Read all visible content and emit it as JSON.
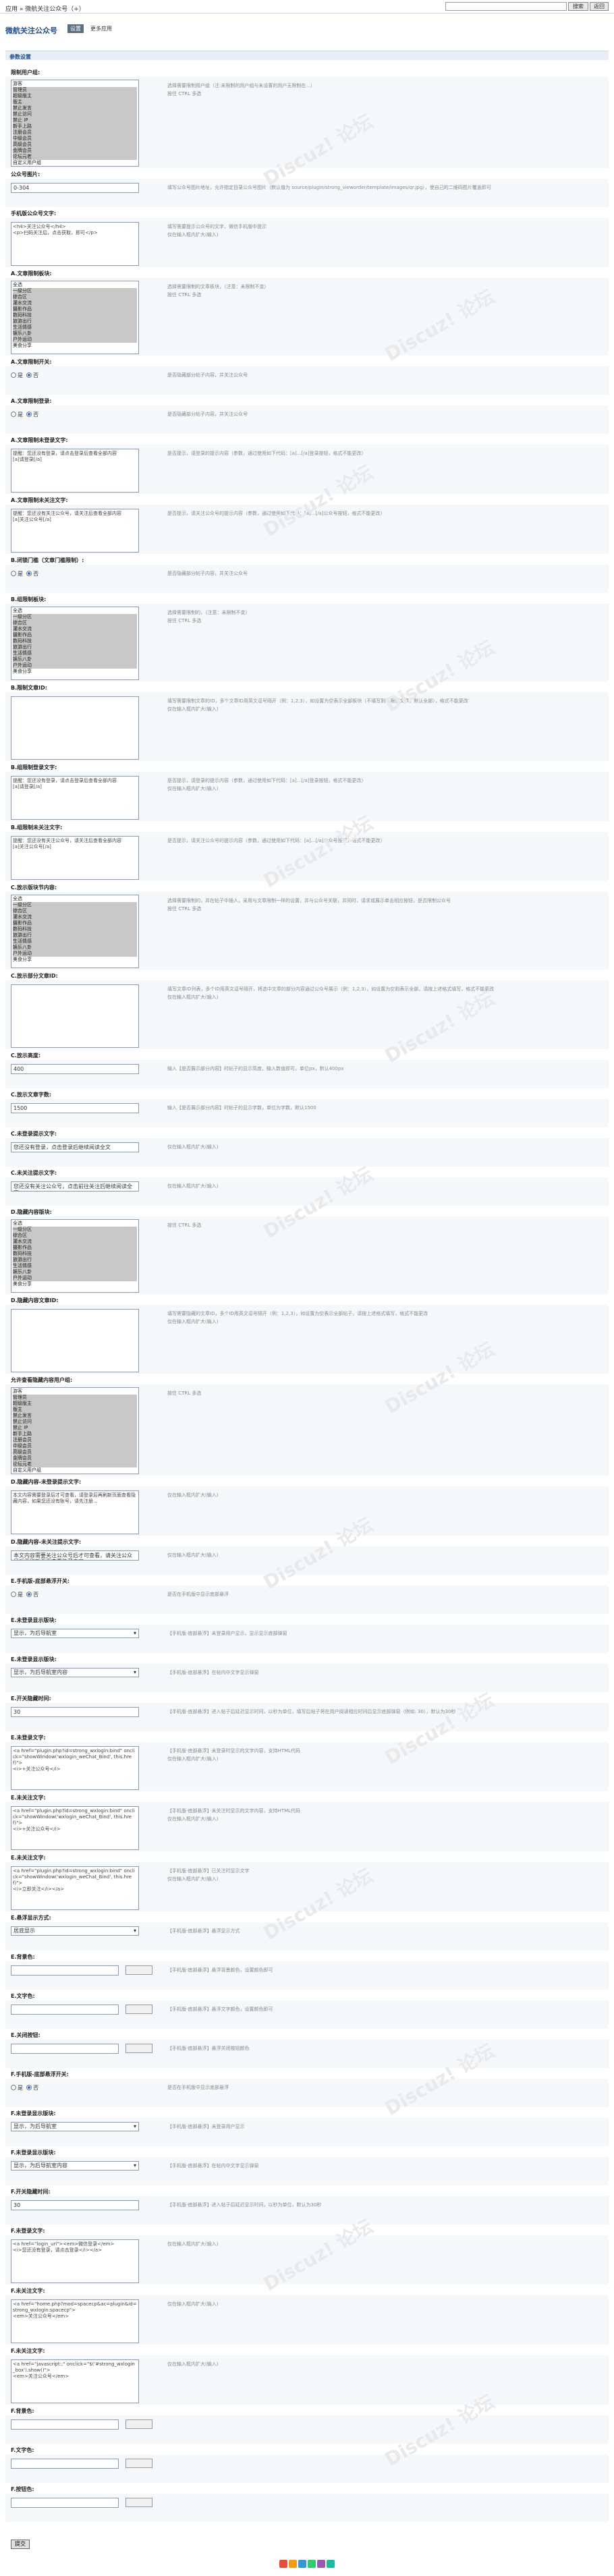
{
  "topbar": {
    "breadcrumb": "应用 » 微航关注公众号（+）",
    "search_button": "搜索",
    "top_button": "返回"
  },
  "header": {
    "title": "微航关注公众号",
    "tab_active": "设置",
    "tab_other": "更多应用"
  },
  "section_title": "参数设置",
  "fields": [
    {
      "label": "限制用户组:",
      "tip": "选择需要限制用户组（注:未限制的用户组与未设置的用户无限制在...）",
      "tip2": "按住 CTRL 多选",
      "options": [
        "游客",
        "管理员",
        "超级版主",
        "版主",
        "禁止发言",
        "禁止访问",
        "禁止 IP",
        "新手上路",
        "注册会员",
        "中级会员",
        "高级会员",
        "金牌会员",
        "论坛元老",
        "自定义用户组"
      ]
    },
    {
      "label": "公众号图片:",
      "value": "0-304",
      "tip": "填写公众号图片地址，允许指定目录公众号图片（默认值为 source/plugin/strong_vieworder/template/images/qr.jpg），使自己的二维码图片覆盖即可"
    },
    {
      "label": "手机版公众号文字:",
      "value": "<h4>关注公众号</h4>\n<p>扫码关注后，点击获取，即可</p>",
      "tip": "填写需要提示公众号的文字，微信手机版中提示",
      "tip2": "仅在输入框内扩大(输入)"
    },
    {
      "label": "A.文章限制板块:",
      "tip": "选择需要限制的文章板块，（注意：未限制不变）",
      "tip2": "按住 CTRL 多选",
      "options": [
        "全选",
        "一级分区",
        "  综合区",
        "  灌水交流",
        "  摄影作品",
        "  数码科技",
        "  旅游出行",
        "  生活情感",
        "  娱乐八卦",
        "  户外运动",
        "  美食分享"
      ]
    },
    {
      "label": "A.文章限制开关:",
      "radio_on": "是",
      "radio_off": "否",
      "tip": "是否隐藏部分帖子内容，并关注公众号"
    },
    {
      "label": "A.文章限制登录:",
      "radio_on": "是",
      "radio_off": "否",
      "tip": "是否隐藏部分帖子内容，并关注公众号"
    },
    {
      "label": "A.文章限制未登录文字:",
      "value": "提醒：您还没有登录，请点击登录后查看全部内容\n[a]请登录[/a]",
      "tip": "是否提示，请登录的提示内容（参数，通过使用如下代码：[a]...[/a]登录按钮，格式不能更改）"
    },
    {
      "label": "A.文章限制未关注文字:",
      "value": "提醒：您还没有关注公众号，请关注后查看全部内容\n[a]关注公众号[/a]",
      "tip": "是否提示，请关注公众号的提示内容（参数，通过使用如下代码：[a]...[/a]公众号按钮，格式不能更改）"
    },
    {
      "label": "B.闭锁门槛（文章门槛限制）:",
      "radio_on": "是",
      "radio_off": "否",
      "tip": "是否隐藏部分帖子内容，并关注公众号"
    },
    {
      "label": "B.组限制板块:",
      "tip": "选择需要限制的，（注意：未限制不变）",
      "tip2": "按住 CTRL 多选",
      "options": [
        "全选",
        "一级分区",
        "  综合区",
        "  灌水交流",
        "  摄影作品",
        "  数码科技",
        "  旅游出行",
        "  生活情感",
        "  娱乐八卦",
        "  户外运动",
        "  美食分享"
      ]
    },
    {
      "label": "B.限制文章ID:",
      "value": "",
      "tip": "填写需要限制文章的ID，多个文章ID用英文逗号隔开（例：1,2,3），如设置为空表示全部板块（不填写则不限制文章，默认全部），格式不能更改",
      "tip2": "仅在输入框内扩大(输入)"
    },
    {
      "label": "B.组限制登录文字:",
      "value": "提醒：您还没有登录，请点击登录后查看全部内容\n[a]请登录[/a]",
      "tip": "是否提示，请登录的提示内容（参数，通过使用如下代码：[a]...[/a]登录按钮，格式不能更改）",
      "tip2": "仅在输入框内扩大(输入)"
    },
    {
      "label": "B.组限制未关注文字:",
      "value": "提醒：您还没有关注公众号，请关注后查看全部内容\n[a]关注公众号[/a]",
      "tip": "是否提示，请关注公众号的提示内容（参数，通过使用如下代码：[a]...[/a]公众号按钮，格式不能更改）"
    },
    {
      "label": "C.放示版块节内容:",
      "tip": "选择需要限制的，并在帖子中插入，采用与文章限制一样的设置，并与公众号关联，并同时，请求或展示单击相应按钮，是否限制公众号",
      "tip2": "按住 CTRL 多选",
      "options": [
        "全选",
        "一级分区",
        "  综合区",
        "  灌水交流",
        "  摄影作品",
        "  数码科技",
        "  旅游出行",
        "  生活情感",
        "  娱乐八卦",
        "  户外运动",
        "  美食分享"
      ]
    },
    {
      "label": "C.放示部分文章ID:",
      "value": "",
      "tip": "填写文章ID列表，多个ID用英文逗号隔开，将选中文章的部分内容通过公众号展示（例：1,2,3），如设置为空则表示全部，请按上述格式填写，格式不能更改",
      "tip2": "仅在输入框内扩大(输入)"
    },
    {
      "label": "C.放示高度:",
      "value": "400",
      "tip": "输入【是否展示部分内容】时帖子的显示高度，输入数值即可，单位px，默认400px"
    },
    {
      "label": "C.放示文章字数:",
      "value": "1500",
      "tip": "输入【是否展示部分内容】时帖子的显示字数，单位为字数，默认1500"
    },
    {
      "label": "C.未登录提示文字:",
      "value": "您还没有登录，点击登录后继续阅读全文",
      "tip": "仅在输入框内扩大(输入)"
    },
    {
      "label": "C.未关注提示文字:",
      "value": "您还没有关注公众号，点击前往关注后继续阅读全文",
      "tip": "仅在输入框内扩大(输入)"
    },
    {
      "label": "D.隐藏内容版块:",
      "tip": "按住 CTRL 多选",
      "options": [
        "全选",
        "一级分区",
        "  综合区",
        "  灌水交流",
        "  摄影作品",
        "  数码科技",
        "  旅游出行",
        "  生活情感",
        "  娱乐八卦",
        "  户外运动",
        "  美食分享"
      ]
    },
    {
      "label": "D.隐藏内容文章ID:",
      "value": "",
      "tip": "填写需要隐藏的文章ID，多个ID用英文逗号隔开（例：1,2,3），如设置为空表示全部帖子，请按上述格式填写，格式不能更改",
      "tip2": "仅在输入框内扩大(输入)"
    },
    {
      "label": "允许查看隐藏内容用户组:",
      "tip": "按住 CTRL 多选",
      "options": [
        "游客",
        "管理员",
        "超级版主",
        "版主",
        "禁止发言",
        "禁止访问",
        "禁止 IP",
        "新手上路",
        "注册会员",
        "中级会员",
        "高级会员",
        "金牌会员",
        "论坛元老",
        "自定义用户组"
      ]
    },
    {
      "label": "D.隐藏内容-未登录提示文字:",
      "value": "本文内容需要登录后才可查看，请登录后再刷新页面查看隐藏内容，如果您还没有账号，请先注册...",
      "tip": "仅在输入框内扩大(输入)"
    },
    {
      "label": "D.隐藏内容-未关注提示文字:",
      "value": "本文内容需要关注公众号后才可查看，请关注公众号后再刷新页面查看隐藏内容...",
      "tip": "仅在输入框内扩大(输入)"
    },
    {
      "label": "E.手机版-底部悬浮开关:",
      "radio_on": "是",
      "radio_off": "否",
      "tip": "是否在手机版中显示底部悬浮"
    },
    {
      "label": "E.未登录显示版块:",
      "dd": "显示，为后导航室",
      "tip": "【手机版-底部悬浮】未登录用户显示，显示显示底部弹窗"
    },
    {
      "label": "E.未登录显示版块:",
      "dd": "显示，为后导航室内容",
      "tip": "【手机版-底部悬浮】在帖内中文字显示弹窗"
    },
    {
      "label": "E.开关隐藏时间:",
      "value": "30",
      "tip": "【手机版-底部悬浮】进入帖子后延迟显示时间，以秒为单位，填写后帖子将在用户阅读相应时间后显示底部弹窗（例如: 30），默认为30秒"
    },
    {
      "label": "E.未登录文字:",
      "value": "<a href=\"plugin.php?id=strong_wxlogin:bind\" onclick=\"showWindow('wxlogin_weChat_Bind', this.href)\">\n<i>+关注公众号</i>",
      "tip": "【手机版-底部悬浮】未登录时显示的文字内容，支持HTML代码",
      "tip2": "仅在输入框内扩大(输入)"
    },
    {
      "label": "E.未关注文字:",
      "value": "<a href=\"plugin.php?id=strong_wxlogin:bind\" onclick=\"showWindow('wxlogin_weChat_Bind', this.href)\">\n<i>+关注公众号</i>",
      "tip": "【手机版-底部悬浮】未关注时显示的文字内容，支持HTML代码",
      "tip2": "仅在输入框内扩大(输入)"
    },
    {
      "label": "E.未关注文字:",
      "value": "<a href=\"plugin.php?id=strong_wxlogin:bind\" onclick=\"showWindow('wxlogin_weChat_Bind', this.href)\">\n<i>立即关注</i></a>",
      "tip": "【手机版-底部悬浮】已关注时显示文字",
      "tip2": "仅在输入框内扩大(输入)"
    },
    {
      "label": "E.悬浮显示方式:",
      "dd": "居底显示",
      "tip": "【手机版-底部悬浮】悬浮显示方式"
    },
    {
      "label": "E.背景色:",
      "value": "",
      "tip": "【手机版-底部悬浮】悬浮背景颜色，设置颜色即可"
    },
    {
      "label": "E.文字色:",
      "value": "",
      "tip": "【手机版-底部悬浮】悬浮文字颜色，设置颜色即可"
    },
    {
      "label": "E.关闭按钮:",
      "value": "",
      "tip": "【手机版-底部悬浮】悬浮关闭按钮颜色"
    },
    {
      "label": "F.手机版-底部悬浮开关:",
      "radio_on": "是",
      "radio_off": "否",
      "tip": "是否在手机版中显示底部悬浮"
    },
    {
      "label": "F.未登录显示版块:",
      "dd": "显示，为后导航室",
      "tip": "【手机版-底部悬浮】未登录用户显示"
    },
    {
      "label": "F.未登录显示版块:",
      "dd": "显示，为后导航室内容",
      "tip": "【手机版-底部悬浮】在帖内中文字显示弹窗"
    },
    {
      "label": "F.开关隐藏时间:",
      "value": "30",
      "tip": "【手机版-底部悬浮】进入帖子后延迟显示时间，以秒为单位，默认为30秒"
    },
    {
      "label": "F.未登录文字:",
      "value": "<a href=\"login_url\"><em>微信登录</em>\n<i>您还没有登录，请点击登录</i></a>",
      "tip": "仅在输入框内扩大(输入)"
    },
    {
      "label": "F.未关注文字:",
      "value": "<a href=\"home.php?mod=spacecp&ac=plugin&id=strong_wxlogin:spacecp\">\n<em>关注公众号</em>",
      "tip": "仅在输入框内扩大(输入)"
    },
    {
      "label": "F.未关注文字:",
      "value": "<a href=\"javascript:;\" onclick=\"$('#strong_wxlogin_box').show()\">\n<em>关注公众号</em>",
      "tip": "仅在输入框内扩大(输入)"
    },
    {
      "label": "F.背景色:",
      "value": "",
      "tip": ""
    },
    {
      "label": "F.文字色:",
      "value": "",
      "tip": ""
    },
    {
      "label": "F.按钮色:",
      "value": "",
      "tip": ""
    }
  ],
  "submit": "提交",
  "watermark": "Discuz! 论坛",
  "colors": {
    "accent": "#1f4f8f",
    "section_bg": "#e7eef6"
  }
}
